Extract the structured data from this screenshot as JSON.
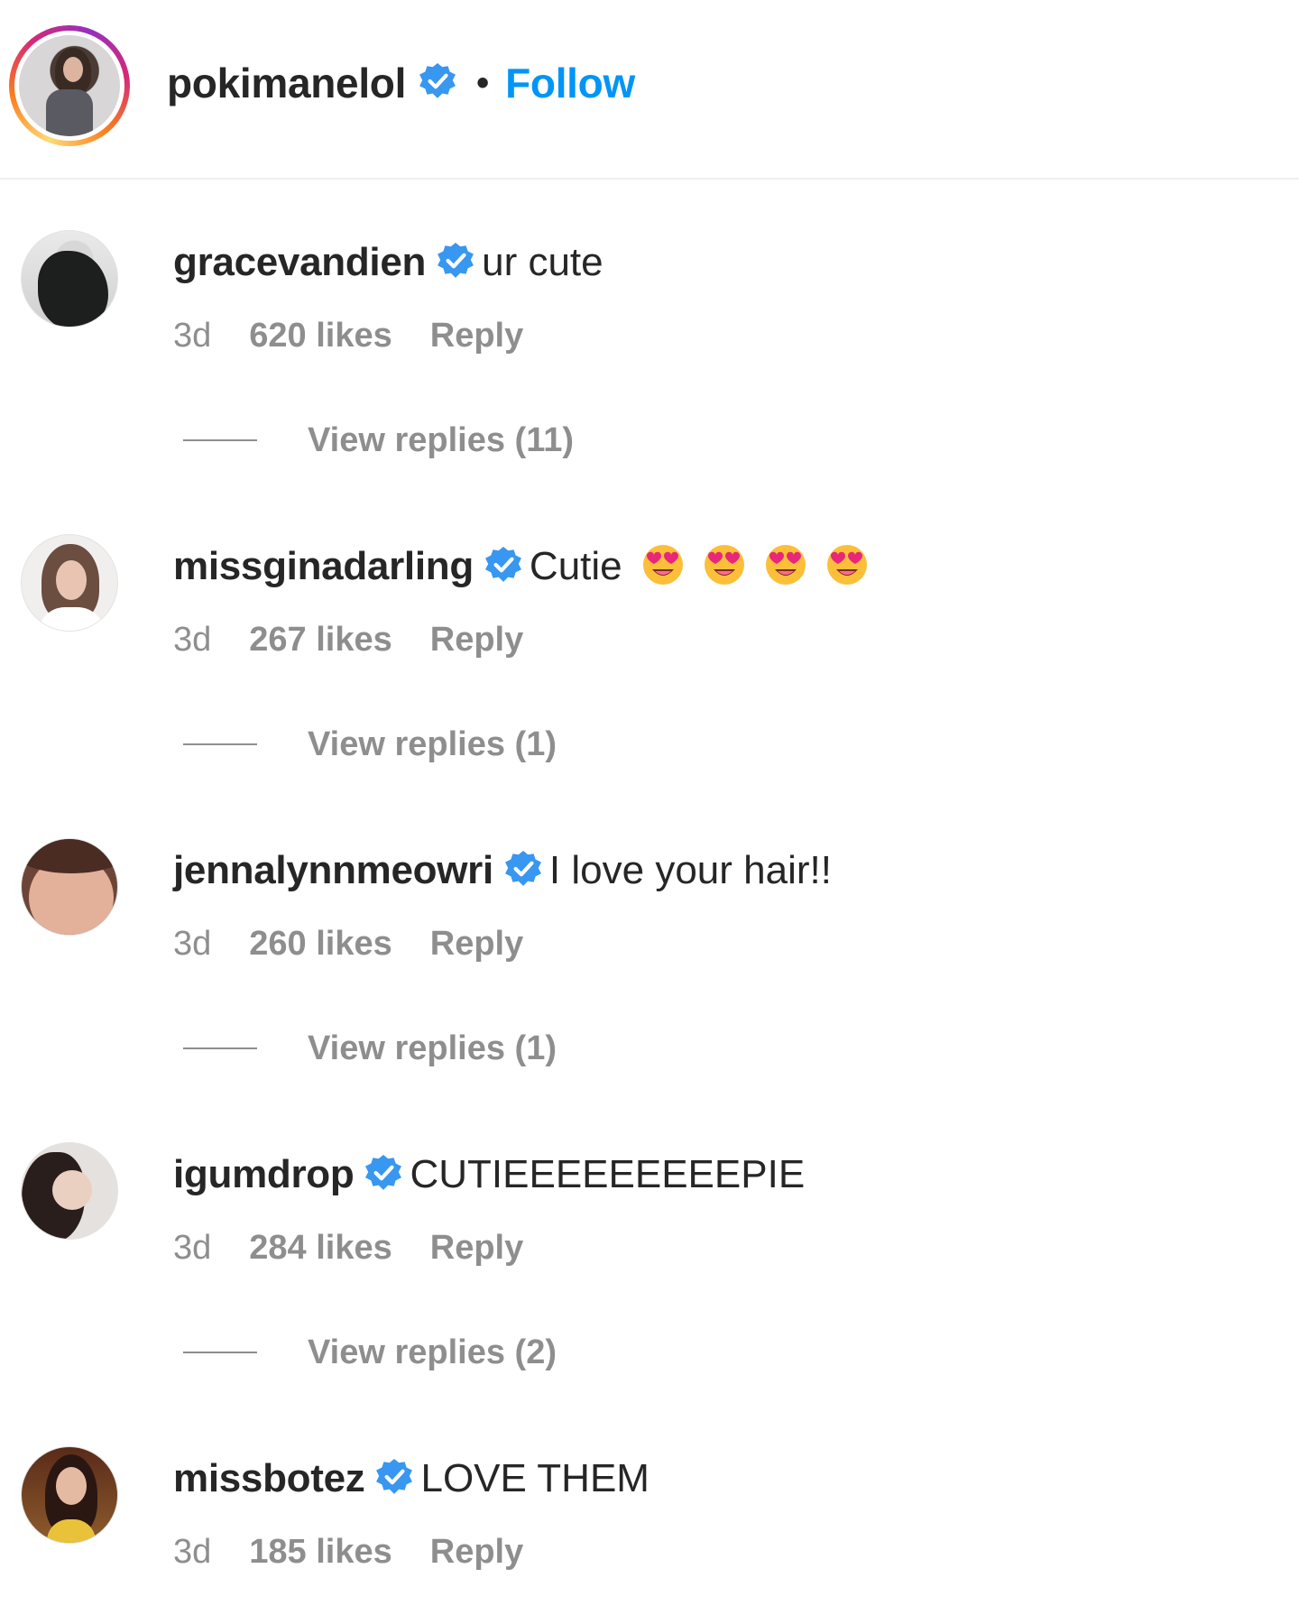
{
  "header": {
    "username": "pokimanelol",
    "separator": "•",
    "follow_label": "Follow"
  },
  "colors": {
    "accent_blue": "#0095f6",
    "verified_blue": "#3897f0",
    "muted_gray": "#8e8e8e",
    "text_dark": "#262626"
  },
  "comments": [
    {
      "username": "gracevandien",
      "text": "ur cute",
      "time": "3d",
      "likes": "620 likes",
      "reply_label": "Reply",
      "view_replies": "View replies (11)"
    },
    {
      "username": "missginadarling",
      "text": "Cutie",
      "emoji_count": 4,
      "emoji_icon": "heart-eyes-emoji",
      "time": "3d",
      "likes": "267 likes",
      "reply_label": "Reply",
      "view_replies": "View replies (1)"
    },
    {
      "username": "jennalynnmeowri",
      "text": "I love your hair!!",
      "time": "3d",
      "likes": "260 likes",
      "reply_label": "Reply",
      "view_replies": "View replies (1)"
    },
    {
      "username": "igumdrop",
      "text": "CUTIEEEEEEEEEPIE",
      "time": "3d",
      "likes": "284 likes",
      "reply_label": "Reply",
      "view_replies": "View replies (2)"
    },
    {
      "username": "missbotez",
      "text": "LOVE THEM",
      "time": "3d",
      "likes": "185 likes",
      "reply_label": "Reply"
    }
  ]
}
